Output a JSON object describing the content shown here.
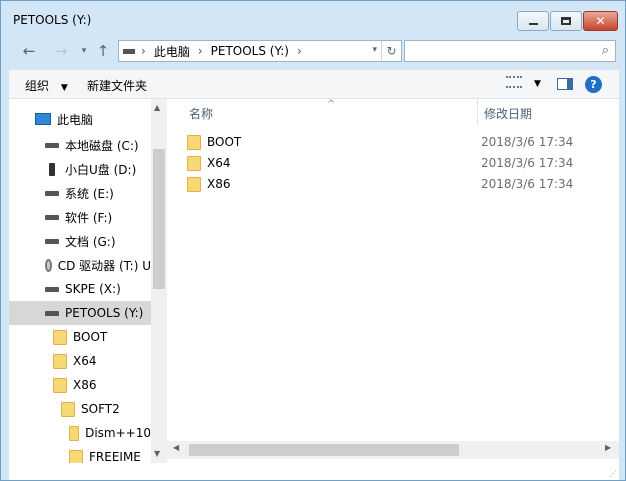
{
  "window": {
    "title": "PETOOLS (Y:)"
  },
  "address": {
    "segments": [
      "此电脑",
      "PETOOLS (Y:)"
    ],
    "separator": "›",
    "search_placeholder": ""
  },
  "toolbar": {
    "organize_label": "组织",
    "new_folder_label": "新建文件夹"
  },
  "nav": {
    "items": [
      {
        "label": "此电脑",
        "icon": "computer-icon"
      },
      {
        "label": "本地磁盘 (C:)",
        "icon": "drive-icon"
      },
      {
        "label": "小白U盘 (D:)",
        "icon": "usb-icon"
      },
      {
        "label": "系统 (E:)",
        "icon": "drive-icon"
      },
      {
        "label": "软件 (F:)",
        "icon": "drive-icon"
      },
      {
        "label": "文档 (G:)",
        "icon": "drive-icon"
      },
      {
        "label": "CD 驱动器 (T:) U",
        "icon": "cd-drive-icon"
      },
      {
        "label": "SKPE (X:)",
        "icon": "drive-icon"
      },
      {
        "label": "PETOOLS (Y:)",
        "icon": "drive-icon"
      },
      {
        "label": "BOOT",
        "icon": "folder-icon"
      },
      {
        "label": "X64",
        "icon": "folder-icon"
      },
      {
        "label": "X86",
        "icon": "folder-icon"
      },
      {
        "label": "SOFT2",
        "icon": "folder-icon"
      },
      {
        "label": "Dism++10",
        "icon": "folder-icon"
      },
      {
        "label": "FREEIME",
        "icon": "folder-icon"
      }
    ]
  },
  "files": {
    "columns": {
      "name": "名称",
      "modified": "修改日期"
    },
    "rows": [
      {
        "name": "BOOT",
        "modified": "2018/3/6 17:34"
      },
      {
        "name": "X64",
        "modified": "2018/3/6 17:34"
      },
      {
        "name": "X86",
        "modified": "2018/3/6 17:34"
      }
    ]
  },
  "colors": {
    "frame": "#d3e6f6",
    "selection": "#d7d7d7",
    "folder": "#f8d775"
  }
}
